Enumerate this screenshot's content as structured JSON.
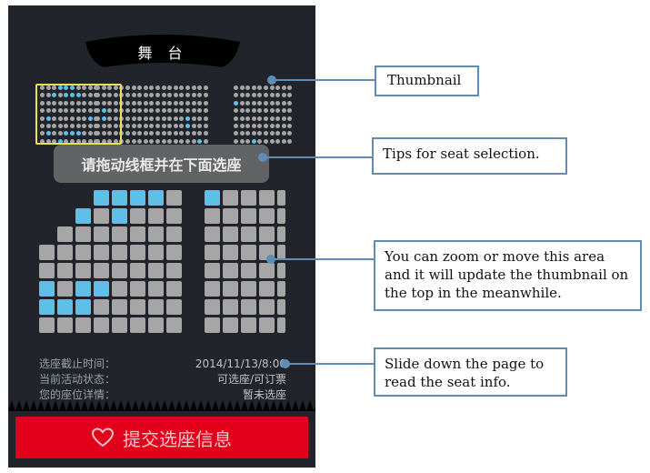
{
  "stage": {
    "label": "舞 台"
  },
  "thumbnail": {
    "blocks": [
      {
        "cols": 10,
        "rows": 8,
        "selected": [
          [
            0,
            3
          ],
          [
            0,
            4
          ],
          [
            0,
            5
          ],
          [
            1,
            2
          ],
          [
            1,
            4
          ],
          [
            1,
            5
          ],
          [
            1,
            6
          ],
          [
            4,
            1
          ],
          [
            4,
            8
          ],
          [
            6,
            1
          ],
          [
            6,
            4
          ],
          [
            6,
            5
          ],
          [
            6,
            6
          ],
          [
            7,
            3
          ]
        ]
      },
      {
        "cols": 19,
        "rows": 8,
        "selected": [
          [
            3,
            1
          ],
          [
            4,
            1
          ],
          [
            4,
            15
          ],
          [
            5,
            15
          ],
          [
            7,
            17
          ]
        ]
      },
      {
        "cols": 10,
        "rows": 8,
        "selected": [
          [
            2,
            0
          ],
          [
            7,
            3
          ]
        ]
      }
    ]
  },
  "tip": {
    "text": "请拖动线框并在下面选座"
  },
  "seat_map": {
    "left_rows": [
      {
        "start": 3,
        "seats": [
          1,
          1,
          1,
          1,
          0
        ]
      },
      {
        "start": 2,
        "seats": [
          1,
          0,
          1,
          0,
          0,
          0
        ]
      },
      {
        "start": 1,
        "seats": [
          0,
          0,
          0,
          0,
          0,
          0,
          0
        ]
      },
      {
        "start": 0,
        "seats": [
          0,
          0,
          0,
          0,
          0,
          0,
          0,
          0
        ]
      },
      {
        "start": 0,
        "seats": [
          0,
          0,
          0,
          0,
          0,
          0,
          0,
          0
        ]
      },
      {
        "start": 0,
        "seats": [
          1,
          0,
          1,
          1,
          0,
          0,
          0,
          0
        ]
      },
      {
        "start": 0,
        "seats": [
          1,
          1,
          1,
          0,
          0,
          0,
          0,
          0
        ]
      },
      {
        "start": 0,
        "seats": [
          0,
          0,
          0,
          0,
          0,
          0,
          0,
          0
        ]
      }
    ],
    "right_rows": [
      [
        1,
        0,
        0,
        0,
        0
      ],
      [
        0,
        0,
        0,
        0,
        0
      ],
      [
        0,
        0,
        0,
        0,
        0
      ],
      [
        0,
        0,
        0,
        0,
        0
      ],
      [
        0,
        0,
        0,
        0,
        0
      ],
      [
        0,
        0,
        0,
        0,
        0
      ],
      [
        0,
        0,
        0,
        0,
        0
      ],
      [
        0,
        0,
        0,
        0,
        0
      ]
    ]
  },
  "info": {
    "rows": [
      {
        "label": "选座截止时间：",
        "value": "2014/11/13/8:00"
      },
      {
        "label": "当前活动状态：",
        "value": "可选座/可订票"
      },
      {
        "label": "您的座位详情：",
        "value": "暂未选座"
      }
    ]
  },
  "submit": {
    "label": "提交选座信息",
    "icon": "heart-icon"
  },
  "callouts": {
    "thumbnail": "Thumbnail",
    "tips": "Tips for seat selection.",
    "zoom": "You can zoom or move this area and it will update the thumbnail on the top in the meanwhile.",
    "slide": "Slide down the page to read the seat info."
  },
  "colors": {
    "phone_bg": "#21252b",
    "seat_available": "#a6a6a6",
    "seat_selected": "#5ebfe8",
    "viewport_frame": "#e8e34a",
    "submit_bg": "#e3001b",
    "callout_border": "#5f8db6"
  }
}
